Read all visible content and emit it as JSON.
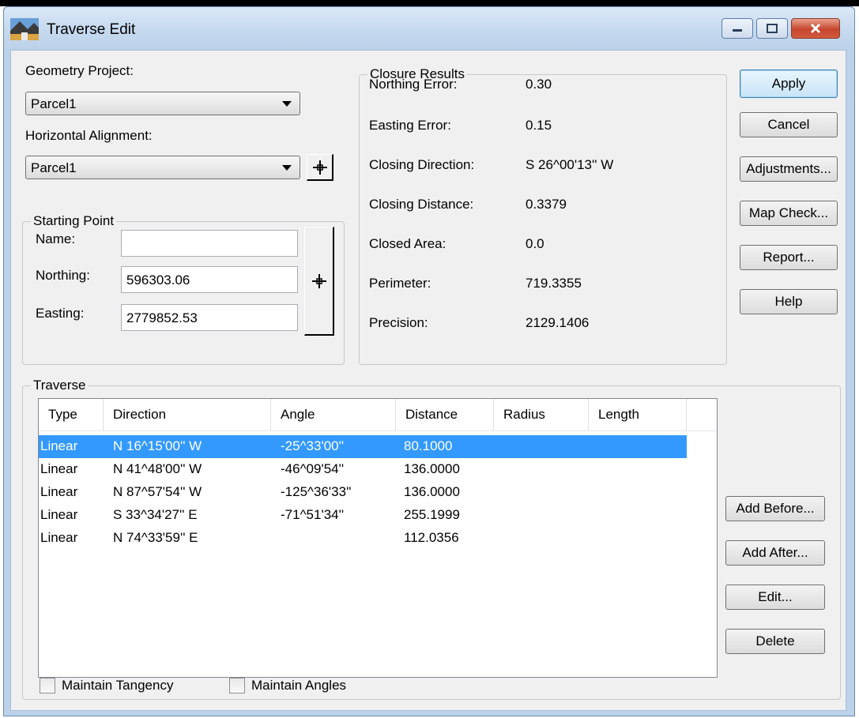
{
  "window": {
    "title": "Traverse Edit"
  },
  "geometry_project": {
    "label": "Geometry Project:",
    "value": "Parcel1"
  },
  "horizontal_alignment": {
    "label": "Horizontal Alignment:",
    "value": "Parcel1"
  },
  "starting_point": {
    "title": "Starting Point",
    "name_label": "Name:",
    "name_value": "",
    "northing_label": "Northing:",
    "northing_value": "596303.06",
    "easting_label": "Easting:",
    "easting_value": "2779852.53"
  },
  "closure": {
    "title": "Closure Results",
    "rows": [
      {
        "label": "Northing Error:",
        "value": "0.30"
      },
      {
        "label": "Easting Error:",
        "value": "0.15"
      },
      {
        "label": "Closing Direction:",
        "value": "S 26^00'13'' W"
      },
      {
        "label": "Closing Distance:",
        "value": "0.3379"
      },
      {
        "label": "Closed Area:",
        "value": "0.0"
      },
      {
        "label": "Perimeter:",
        "value": "719.3355"
      },
      {
        "label": "Precision:",
        "value": "2129.1406"
      }
    ]
  },
  "buttons": {
    "apply": "Apply",
    "cancel": "Cancel",
    "adjustments": "Adjustments...",
    "map_check": "Map Check...",
    "report": "Report...",
    "help": "Help",
    "add_before": "Add Before...",
    "add_after": "Add After...",
    "edit": "Edit...",
    "delete": "Delete"
  },
  "traverse": {
    "title": "Traverse",
    "columns": [
      "Type",
      "Direction",
      "Angle",
      "Distance",
      "Radius",
      "Length"
    ],
    "rows": [
      [
        "Linear",
        "N 16^15'00'' W",
        "-25^33'00''",
        "80.1000",
        "",
        ""
      ],
      [
        "Linear",
        "N 41^48'00'' W",
        "-46^09'54''",
        "136.0000",
        "",
        ""
      ],
      [
        "Linear",
        "N 87^57'54'' W",
        "-125^36'33''",
        "136.0000",
        "",
        ""
      ],
      [
        "Linear",
        "S 33^34'27'' E",
        "-71^51'34''",
        "255.1999",
        "",
        ""
      ],
      [
        "Linear",
        "N 74^33'59'' E",
        "",
        "112.0356",
        "",
        ""
      ]
    ],
    "selected_row": 0
  },
  "checkboxes": {
    "maintain_tangency": {
      "label": "Maintain Tangency",
      "checked": false
    },
    "maintain_angles": {
      "label": "Maintain Angles",
      "checked": false
    }
  },
  "icons": [
    "app-icon",
    "minimize-icon",
    "maximize-icon",
    "close-icon",
    "crosshair-icon"
  ],
  "colors": {
    "selection": "#3399ff",
    "titlebar": "#c4d8ee",
    "close_button": "#c6462d"
  }
}
